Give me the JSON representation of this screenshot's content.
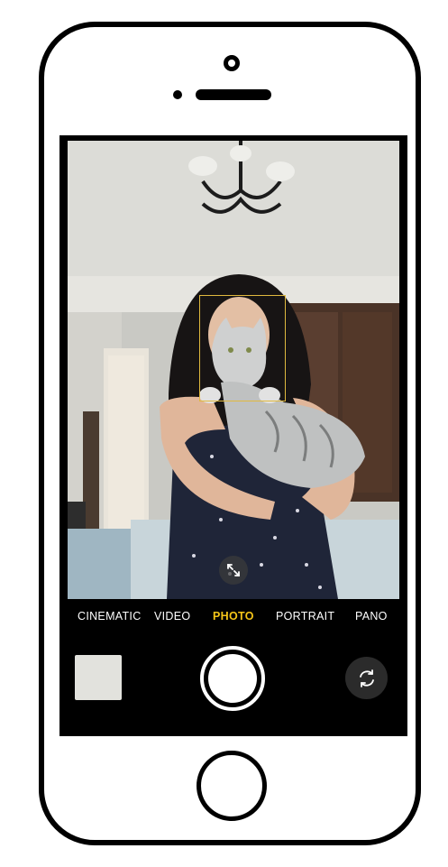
{
  "camera": {
    "modes": [
      {
        "label": "CINEMATIC",
        "active": false
      },
      {
        "label": "VIDEO",
        "active": false
      },
      {
        "label": "PHOTO",
        "active": true
      },
      {
        "label": "PORTRAIT",
        "active": false
      },
      {
        "label": "PANO",
        "active": false
      }
    ],
    "active_mode_color": "#f5c518",
    "face_box_color": "#e0b93f",
    "icons": {
      "expand": "expand-arrows-icon",
      "flip": "camera-flip-icon",
      "shutter": "shutter-button",
      "thumbnail": "last-photo-thumbnail"
    }
  }
}
